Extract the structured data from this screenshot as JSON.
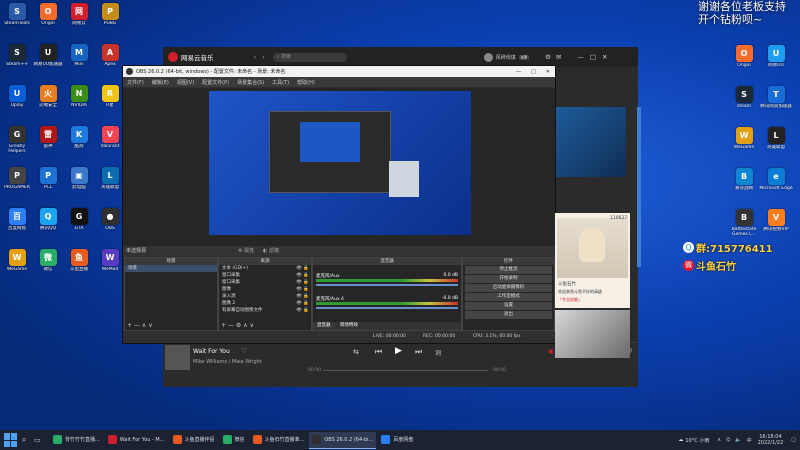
{
  "overlay": {
    "thanks_line1": "谢谢各位老板支持",
    "thanks_line2": "开个钻粉呗~",
    "qq_label": "群:715776411",
    "weibo_label": "斗鱼石竹"
  },
  "desktop_icons_left": [
    {
      "label": "SteamTools",
      "color": "#2b5aa8",
      "glyph": "S"
    },
    {
      "label": "Steam++",
      "color": "#1b2838",
      "glyph": "S"
    },
    {
      "label": "Uplay",
      "color": "#0a5fd8",
      "glyph": "U"
    },
    {
      "label": "Greatly Helpers",
      "color": "#333",
      "glyph": "G"
    },
    {
      "label": "PROGAMER",
      "color": "#444",
      "glyph": "P"
    },
    {
      "label": "百度网盘",
      "color": "#2d7ff9",
      "glyph": "百"
    },
    {
      "label": "WeGame",
      "color": "#e3a012",
      "glyph": "W"
    },
    {
      "label": "Origin",
      "color": "#f56c2d",
      "glyph": "O"
    },
    {
      "label": "网易UU加速器",
      "color": "#222",
      "glyph": "U"
    },
    {
      "label": "火绒安全",
      "color": "#e87d1f",
      "glyph": "火"
    },
    {
      "label": "雷神",
      "color": "#b01818",
      "glyph": "雷"
    },
    {
      "label": "PCL",
      "color": "#1e73d2",
      "glyph": "P"
    },
    {
      "label": "腾讯QQ",
      "color": "#1aa3f0",
      "glyph": "Q"
    },
    {
      "label": "微信",
      "color": "#2aae67",
      "glyph": "微"
    },
    {
      "label": "网易云",
      "color": "#d01f2c",
      "glyph": "网"
    },
    {
      "label": "Mini",
      "color": "#1565c0",
      "glyph": "M"
    },
    {
      "label": "NVIDIA",
      "color": "#3c8c18",
      "glyph": "N"
    },
    {
      "label": "酷狗",
      "color": "#1f7ae0",
      "glyph": "K"
    },
    {
      "label": "此电脑",
      "color": "#3a78c9",
      "glyph": "▣"
    },
    {
      "label": "GTA",
      "color": "#111",
      "glyph": "G"
    },
    {
      "label": "斗鱼直播",
      "color": "#e55b20",
      "glyph": "鱼"
    },
    {
      "label": "PUBG",
      "color": "#c28e18",
      "glyph": "P"
    },
    {
      "label": "Apex",
      "color": "#c8342a",
      "glyph": "A"
    },
    {
      "label": "R星",
      "color": "#f1c40f",
      "glyph": "R"
    },
    {
      "label": "Valorant",
      "color": "#fa4454",
      "glyph": "V"
    },
    {
      "label": "英雄联盟",
      "color": "#0b6db0",
      "glyph": "L"
    },
    {
      "label": "OBS",
      "color": "#302e31",
      "glyph": "●"
    },
    {
      "label": "WeMod",
      "color": "#5a3cc2",
      "glyph": "W"
    }
  ],
  "desktop_icons_right": [
    {
      "label": "Origin",
      "color": "#f56c2d",
      "glyph": "O"
    },
    {
      "label": "网易UU",
      "color": "#1e9cf0",
      "glyph": "U"
    },
    {
      "label": "steam",
      "color": "#1b2838",
      "glyph": "S"
    },
    {
      "label": "腾讯网游加速器",
      "color": "#1a6cd8",
      "glyph": "T"
    },
    {
      "label": "WeGame",
      "color": "#e3a012",
      "glyph": "W"
    },
    {
      "label": "英雄联盟",
      "color": "#222",
      "glyph": "L"
    },
    {
      "label": "暴雪战网",
      "color": "#0e86d4",
      "glyph": "B"
    },
    {
      "label": "Microsoft Edge",
      "color": "#0c7cd5",
      "glyph": "e"
    },
    {
      "label": "Battlestate Games L...",
      "color": "#333",
      "glyph": "B"
    },
    {
      "label": "腾讯视频VIP",
      "color": "#ff7e1d",
      "glyph": "V"
    }
  ],
  "music_app": {
    "title": "网易云音乐",
    "search_placeholder": "搜索",
    "user": "风碎伐琪",
    "song_title": "Wait For You",
    "artist": "Mike Williams / Maia Wright",
    "time_start": "00:00",
    "time_end": "00:00",
    "nav_left": "播放",
    "vip_badge": "VIP"
  },
  "obs": {
    "title": "OBS 26.0.2 (64-bit, windows) - 配置文件: 未命名 - 场景: 未命名",
    "menu": [
      "文件(F)",
      "编辑(E)",
      "视图(V)",
      "配置文件(P)",
      "场景集合(S)",
      "工具(T)",
      "帮助(H)"
    ],
    "no_source": "未选择源",
    "btn_props": "属性",
    "btn_filters": "滤镜",
    "scenes_header": "场景",
    "scenes": [
      "场景"
    ],
    "sources_header": "来源",
    "sources": [
      "文本 (GDI+)",
      "窗口采集",
      "窗口采集",
      "图像",
      "录入源",
      "图像 2",
      "有屏幕自动图像文件"
    ],
    "mixer_header": "混音器",
    "mixer": [
      {
        "name": "麦克风/Aux",
        "db": "0.0 dB"
      },
      {
        "name": "麦克风/Aux 4",
        "db": "-0.0 dB"
      }
    ],
    "transitions_header": "转场特效",
    "controls_header": "控件",
    "controls": [
      "停止推流",
      "开始录制",
      "启动虚拟摄像机",
      "工作室模式",
      "设置",
      "退出"
    ],
    "tab_mixer": "混音器",
    "tab_transitions": "转场特效",
    "status": {
      "live": "LIVE: 00:00:00",
      "rec": "REC: 00:00:00",
      "cpu": "CPU: 3.1%, 60.00 fps"
    }
  },
  "chat_card": {
    "name": "斗鱼石竹",
    "count": "110627",
    "text1": "欢迎来到斗鱼不好的高级",
    "text2": "「专业陪聊」"
  },
  "taskbar": {
    "items": [
      {
        "label": "背竹竹竹直播...",
        "color": "#2aae67",
        "active": false
      },
      {
        "label": "Wait For You - M...",
        "color": "#d01f2c",
        "active": false
      },
      {
        "label": "斗鱼直播伴侣",
        "color": "#e55b20",
        "active": false
      },
      {
        "label": "微信",
        "color": "#2aae67",
        "active": false
      },
      {
        "label": "斗鱼石竹直播准...",
        "color": "#e55b20",
        "active": false
      },
      {
        "label": "OBS 26.0.2 (64-bi...",
        "color": "#302e31",
        "active": true
      },
      {
        "label": "百度网盘",
        "color": "#2d7ff9",
        "active": false
      }
    ],
    "weather": "10°C 小雨",
    "ime": "中",
    "time": "16:18:04",
    "date": "2022/1/22"
  }
}
